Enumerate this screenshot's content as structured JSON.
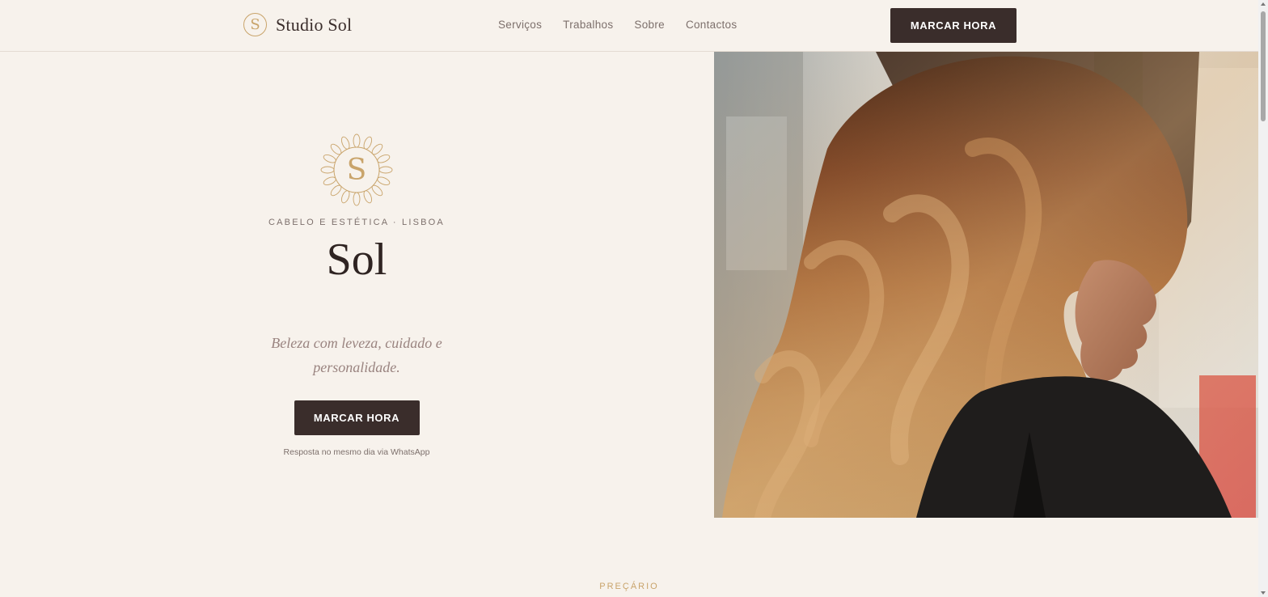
{
  "header": {
    "brand_mark": "S",
    "brand_name": "Studio Sol",
    "nav": [
      "Serviços",
      "Trabalhos",
      "Sobre",
      "Contactos"
    ],
    "cta_label": "MARCAR HORA"
  },
  "hero": {
    "emblem_letter": "S",
    "eyebrow": "CABELO E ESTÉTICA · LISBOA",
    "title": "Sol",
    "tagline": "Beleza com leveza, cuidado e personalidade.",
    "cta_label": "MARCAR HORA",
    "note": "Resposta no mesmo dia via WhatsApp",
    "photo_icon": "hair-photo"
  },
  "next_section": {
    "eyebrow": "PREÇÁRIO"
  },
  "colors": {
    "background": "#f7f2ec",
    "accent_gold": "#c9a46b",
    "dark_button": "#3a2d2b",
    "muted_text": "#7d706c",
    "tagline_text": "#9a8480"
  }
}
